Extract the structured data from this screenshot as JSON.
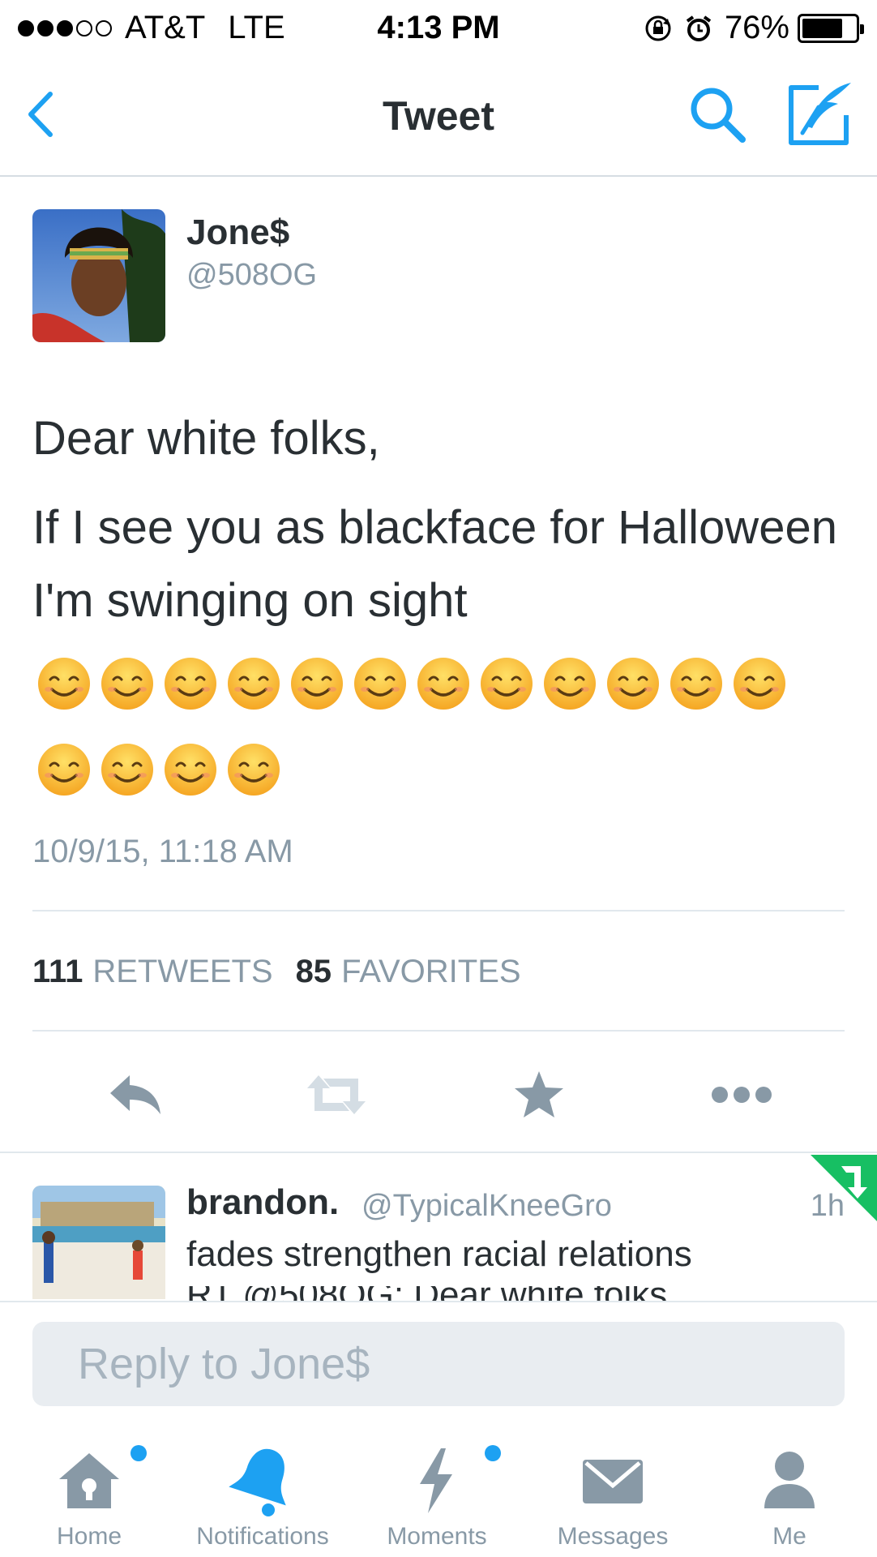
{
  "status_bar": {
    "carrier": "AT&T",
    "network": "LTE",
    "time": "4:13 PM",
    "battery": "76%",
    "battery_level": 0.76,
    "signal_bars": 3,
    "signal_total": 5
  },
  "nav": {
    "title": "Tweet",
    "back_icon": "chevron-left-icon",
    "search_icon": "search-icon",
    "compose_icon": "compose-quill-icon"
  },
  "tweet": {
    "author_name": "Jone$",
    "author_handle": "@508OG",
    "text_line1": "Dear white folks,",
    "text_line2": "If I see you as blackface for Halloween I'm swinging on sight",
    "emoji": "😊",
    "emoji_count": 16,
    "timestamp": "10/9/15, 11:18 AM",
    "retweets_count": "111",
    "retweets_label": "RETWEETS",
    "favorites_count": "85",
    "favorites_label": "FAVORITES"
  },
  "actions": {
    "reply_icon": "reply-icon",
    "retweet_icon": "retweet-icon",
    "favorite_icon": "star-icon",
    "more_icon": "more-dots-icon"
  },
  "reply_preview": {
    "name": "brandon.",
    "handle": "@TypicalKneeGro",
    "time": "1h",
    "text": "fades strengthen racial relations",
    "text_cut": "RT @508OG: Dear white folks"
  },
  "reply_bar": {
    "placeholder": "Reply to Jone$"
  },
  "tabs": [
    {
      "label": "Home",
      "icon": "home-icon",
      "active": false,
      "dot": true
    },
    {
      "label": "Notifications",
      "icon": "bell-icon",
      "active": true,
      "dot": false
    },
    {
      "label": "Moments",
      "icon": "lightning-icon",
      "active": false,
      "dot": true
    },
    {
      "label": "Messages",
      "icon": "envelope-icon",
      "active": false,
      "dot": false
    },
    {
      "label": "Me",
      "icon": "person-icon",
      "active": false,
      "dot": false
    }
  ],
  "colors": {
    "accent": "#1da1f2",
    "text": "#292f33",
    "muted": "#8899a6",
    "divider": "#e1e8ed",
    "retweet_green": "#17bf63"
  }
}
